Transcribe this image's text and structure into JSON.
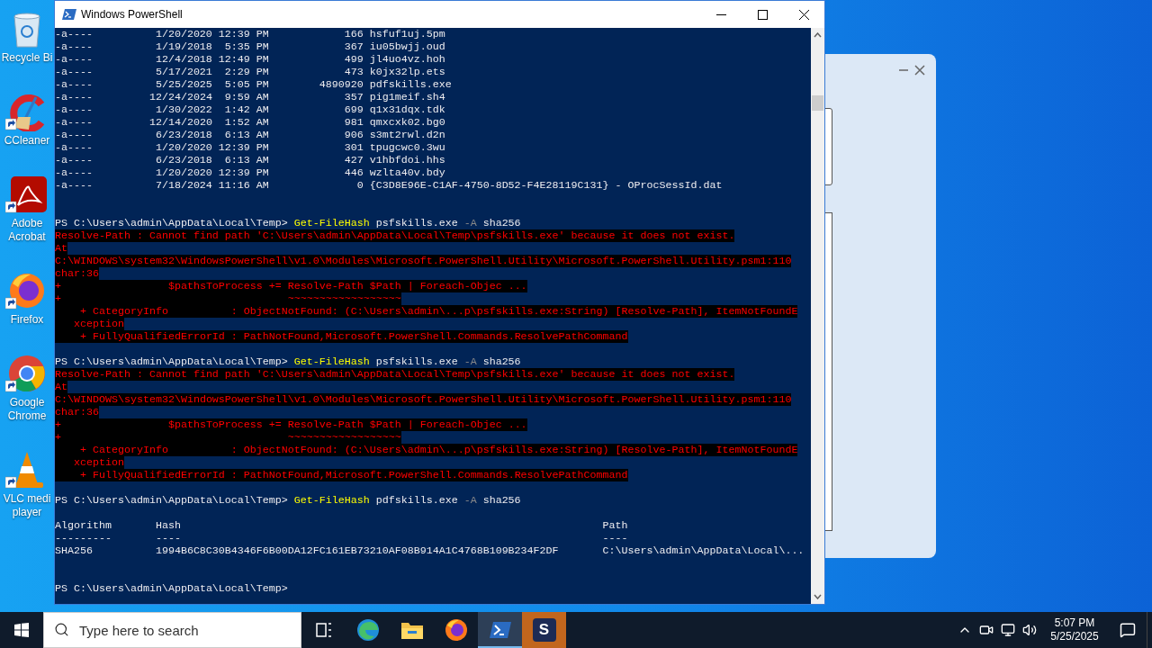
{
  "desktop_icons": [
    {
      "kind": "bin",
      "label": "Recycle Bi",
      "shortcut": false
    },
    {
      "kind": "cleaner",
      "label": "CCleaner",
      "shortcut": true
    },
    {
      "kind": "pdf",
      "label": "Adobe Acrobat",
      "shortcut": true
    },
    {
      "kind": "firefox",
      "label": "Firefox",
      "shortcut": true
    },
    {
      "kind": "chrome",
      "label": "Google Chrome",
      "shortcut": true
    },
    {
      "kind": "vlc",
      "label": "VLC medi player",
      "shortcut": true
    }
  ],
  "window": {
    "title": "Windows PowerShell",
    "lines": [
      {
        "kind": "file",
        "mode": "-a----",
        "date": "1/20/2020",
        "time": "12:39 PM",
        "length": "166",
        "name": "hsfuf1uj.5pm"
      },
      {
        "kind": "file",
        "mode": "-a----",
        "date": "1/19/2018",
        "time": "5:35 PM",
        "length": "367",
        "name": "iu05bwjj.oud"
      },
      {
        "kind": "file",
        "mode": "-a----",
        "date": "12/4/2018",
        "time": "12:49 PM",
        "length": "499",
        "name": "jl4uo4vz.hoh"
      },
      {
        "kind": "file",
        "mode": "-a----",
        "date": "5/17/2021",
        "time": "2:29 PM",
        "length": "473",
        "name": "k0jx32lp.ets"
      },
      {
        "kind": "file",
        "mode": "-a----",
        "date": "5/25/2025",
        "time": "5:05 PM",
        "length": "4890920",
        "name": "pdfskills.exe"
      },
      {
        "kind": "file",
        "mode": "-a----",
        "date": "12/24/2024",
        "time": "9:59 AM",
        "length": "357",
        "name": "pig1meif.sh4"
      },
      {
        "kind": "file",
        "mode": "-a----",
        "date": "1/30/2022",
        "time": "1:42 AM",
        "length": "699",
        "name": "q1x31dqx.tdk"
      },
      {
        "kind": "file",
        "mode": "-a----",
        "date": "12/14/2020",
        "time": "1:52 AM",
        "length": "981",
        "name": "qmxcxk02.bg0"
      },
      {
        "kind": "file",
        "mode": "-a----",
        "date": "6/23/2018",
        "time": "6:13 AM",
        "length": "906",
        "name": "s3mt2rwl.d2n"
      },
      {
        "kind": "file",
        "mode": "-a----",
        "date": "1/20/2020",
        "time": "12:39 PM",
        "length": "301",
        "name": "tpugcwc0.3wu"
      },
      {
        "kind": "file",
        "mode": "-a----",
        "date": "6/23/2018",
        "time": "6:13 AM",
        "length": "427",
        "name": "v1hbfdoi.hhs"
      },
      {
        "kind": "file",
        "mode": "-a----",
        "date": "1/20/2020",
        "time": "12:39 PM",
        "length": "446",
        "name": "wzlta40v.bdy"
      },
      {
        "kind": "file",
        "mode": "-a----",
        "date": "7/18/2024",
        "time": "11:16 AM",
        "length": "0",
        "name": "{C3D8E96E-C1AF-4750-8D52-F4E28119C131} - OProcSessId.dat"
      },
      {
        "kind": "blank"
      },
      {
        "kind": "blank"
      },
      {
        "kind": "prompt",
        "prompt": "PS C:\\Users\\admin\\AppData\\Local\\Temp>",
        "cmdlet": "Get-FileHash",
        "target": "psfskills.exe",
        "param": "-A",
        "value": "sha256"
      },
      {
        "kind": "error",
        "text": "Resolve-Path : Cannot find path 'C:\\Users\\admin\\AppData\\Local\\Temp\\psfskills.exe' because it does not exist."
      },
      {
        "kind": "error",
        "text": "At"
      },
      {
        "kind": "error",
        "text": "C:\\WINDOWS\\system32\\WindowsPowerShell\\v1.0\\Modules\\Microsoft.PowerShell.Utility\\Microsoft.PowerShell.Utility.psm1:110"
      },
      {
        "kind": "error",
        "text": "char:36"
      },
      {
        "kind": "error",
        "text": "+                 $pathsToProcess += Resolve-Path $Path | Foreach-Objec ..."
      },
      {
        "kind": "error",
        "text": "+                                    ~~~~~~~~~~~~~~~~~~"
      },
      {
        "kind": "error",
        "text": "    + CategoryInfo          : ObjectNotFound: (C:\\Users\\admin\\...p\\psfskills.exe:String) [Resolve-Path], ItemNotFoundE"
      },
      {
        "kind": "error",
        "text": "   xception"
      },
      {
        "kind": "error",
        "text": "    + FullyQualifiedErrorId : PathNotFound,Microsoft.PowerShell.Commands.ResolvePathCommand"
      },
      {
        "kind": "blank"
      },
      {
        "kind": "prompt",
        "prompt": "PS C:\\Users\\admin\\AppData\\Local\\Temp>",
        "cmdlet": "Get-FileHash",
        "target": "psfskills.exe",
        "param": "-A",
        "value": "sha256"
      },
      {
        "kind": "error",
        "text": "Resolve-Path : Cannot find path 'C:\\Users\\admin\\AppData\\Local\\Temp\\psfskills.exe' because it does not exist."
      },
      {
        "kind": "error",
        "text": "At"
      },
      {
        "kind": "error",
        "text": "C:\\WINDOWS\\system32\\WindowsPowerShell\\v1.0\\Modules\\Microsoft.PowerShell.Utility\\Microsoft.PowerShell.Utility.psm1:110"
      },
      {
        "kind": "error",
        "text": "char:36"
      },
      {
        "kind": "error",
        "text": "+                 $pathsToProcess += Resolve-Path $Path | Foreach-Objec ..."
      },
      {
        "kind": "error",
        "text": "+                                    ~~~~~~~~~~~~~~~~~~"
      },
      {
        "kind": "error",
        "text": "    + CategoryInfo          : ObjectNotFound: (C:\\Users\\admin\\...p\\psfskills.exe:String) [Resolve-Path], ItemNotFoundE"
      },
      {
        "kind": "error",
        "text": "   xception"
      },
      {
        "kind": "error",
        "text": "    + FullyQualifiedErrorId : PathNotFound,Microsoft.PowerShell.Commands.ResolvePathCommand"
      },
      {
        "kind": "blank"
      },
      {
        "kind": "prompt",
        "prompt": "PS C:\\Users\\admin\\AppData\\Local\\Temp>",
        "cmdlet": "Get-FileHash",
        "target": "pdfskills.exe",
        "param": "-A",
        "value": "sha256"
      },
      {
        "kind": "blank"
      },
      {
        "kind": "columns",
        "cells": [
          "Algorithm",
          "Hash",
          "Path"
        ]
      },
      {
        "kind": "columns",
        "cells": [
          "---------",
          "----",
          "----"
        ]
      },
      {
        "kind": "columns",
        "cells": [
          "SHA256",
          "1994B6C8C30B4346F6B00DA12FC161EB73210AF08B914A1C4768B109B234F2DF",
          "C:\\Users\\admin\\AppData\\Local\\..."
        ]
      },
      {
        "kind": "blank"
      },
      {
        "kind": "blank"
      },
      {
        "kind": "prompt",
        "prompt": "PS C:\\Users\\admin\\AppData\\Local\\Temp>"
      }
    ]
  },
  "taskbar": {
    "search_placeholder": "Type here to search",
    "apps": [
      {
        "kind": "taskview",
        "selected": false
      },
      {
        "kind": "edge",
        "selected": false
      },
      {
        "kind": "explorer",
        "selected": false
      },
      {
        "kind": "firefox",
        "selected": false
      },
      {
        "kind": "powershell",
        "selected": true
      },
      {
        "kind": "letter",
        "glyph": "S",
        "selected": false
      }
    ],
    "clock": {
      "time": "5:07 PM",
      "date": "5/25/2025"
    }
  }
}
